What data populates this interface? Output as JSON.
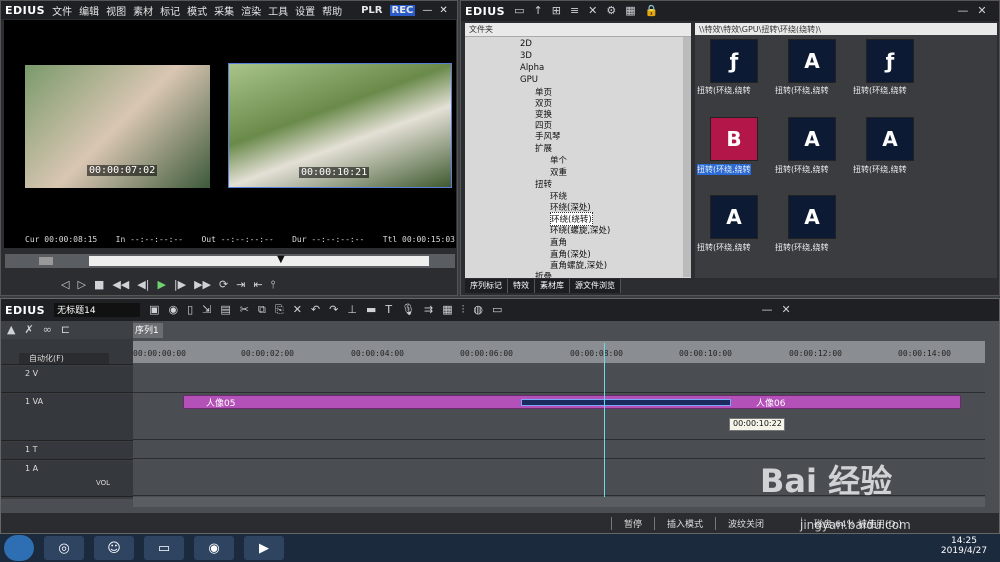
{
  "player": {
    "logo": "EDIUS",
    "menu": [
      "文件",
      "编辑",
      "视图",
      "素材",
      "标记",
      "模式",
      "采集",
      "渲染",
      "工具",
      "设置",
      "帮助"
    ],
    "plr": "PLR",
    "rec": "REC",
    "left_tc": "00:00:07:02",
    "right_tc": "00:00:10:21",
    "cur": "Cur 00:00:08:15",
    "in": "In --:--:--:--",
    "out": "Out --:--:--:--",
    "dur": "Dur --:--:--:--",
    "ttl": "Ttl 00:00:15:03"
  },
  "bin": {
    "logo": "EDIUS",
    "tree_header": "文件夹",
    "path": "\\\\特效\\特效\\GPU\\扭转\\环绕(绕转)\\",
    "tree": [
      {
        "label": "2D"
      },
      {
        "label": "3D"
      },
      {
        "label": "Alpha"
      },
      {
        "label": "GPU"
      },
      {
        "label": "单页"
      },
      {
        "label": "双页"
      },
      {
        "label": "变换"
      },
      {
        "label": "四页"
      },
      {
        "label": "手风琴"
      },
      {
        "label": "扩展"
      },
      {
        "label": "单个"
      },
      {
        "label": "双重"
      },
      {
        "label": "扭转"
      },
      {
        "label": "环绕"
      },
      {
        "label": "环绕(深处)"
      },
      {
        "label": "环绕(绕转)"
      },
      {
        "label": "环绕(螺旋,深处)"
      },
      {
        "label": "直角"
      },
      {
        "label": "直角(深处)"
      },
      {
        "label": "直角螺旋,深处)"
      },
      {
        "label": "折叠"
      }
    ],
    "thumb_labels": [
      "扭转(环绕,绕转",
      "扭转(环绕,绕转",
      "扭转(环绕,绕转",
      "扭转(环绕,绕转",
      "扭转(环绕,绕转",
      "扭转(环绕,绕转",
      "扭转(环绕,绕转",
      "扭转(环绕,绕转"
    ],
    "tabs": [
      "序列标记",
      "特效",
      "素材库",
      "源文件浏览"
    ]
  },
  "timeline": {
    "logo": "EDIUS",
    "project": "无标题14",
    "seq_tab": "序列1",
    "auto": "自动化(F)",
    "tracks": [
      "2 V",
      "1 VA",
      "1 T",
      "1 A"
    ],
    "vol": "VOL",
    "ruler": [
      "00:00:00:00",
      "00:00:02:00",
      "00:00:04:00",
      "00:00:06:00",
      "00:00:08:00",
      "00:00:10:00",
      "00:00:12:00",
      "00:00:14:00"
    ],
    "clip_a": "人像05",
    "clip_b": "人像06",
    "tooltip": "00:00:10:22",
    "status": [
      "暂停",
      "插入模式",
      "波纹关闭",
      "",
      "磁盘:64% 被使用(D:)"
    ]
  },
  "taskbar": {
    "time": "14:25",
    "date": "2019/4/27"
  },
  "watermark": {
    "main": "Bai 经验",
    "sub": "jingyan.baidu.com"
  }
}
